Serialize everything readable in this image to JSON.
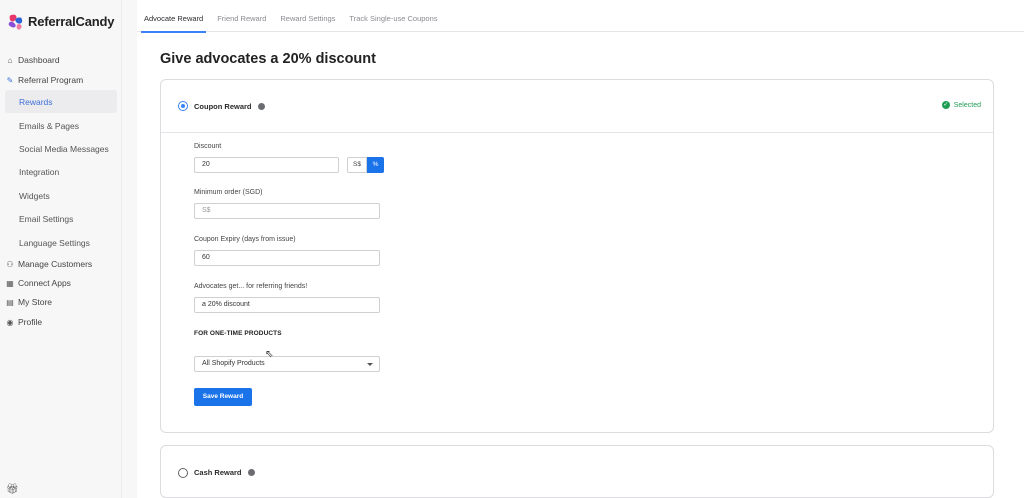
{
  "brand": {
    "name": "ReferralCandy"
  },
  "sidebar": {
    "items": [
      {
        "label": "Dashboard",
        "icon": "home-icon"
      },
      {
        "label": "Referral Program",
        "icon": "edit-icon"
      },
      {
        "label": "Manage Customers",
        "icon": "users-icon"
      },
      {
        "label": "Connect Apps",
        "icon": "grid-icon"
      },
      {
        "label": "My Store",
        "icon": "store-icon"
      },
      {
        "label": "Profile",
        "icon": "profile-icon"
      }
    ],
    "sub_items": [
      {
        "label": "Rewards",
        "active": true
      },
      {
        "label": "Emails & Pages"
      },
      {
        "label": "Social Media Messages"
      },
      {
        "label": "Integration"
      },
      {
        "label": "Widgets"
      },
      {
        "label": "Email Settings"
      },
      {
        "label": "Language Settings"
      }
    ]
  },
  "tabs": [
    {
      "label": "Advocate Reward",
      "active": true
    },
    {
      "label": "Friend Reward"
    },
    {
      "label": "Reward Settings"
    },
    {
      "label": "Track Single-use Coupons"
    }
  ],
  "page_title": "Give advocates a 20% discount",
  "coupon_card": {
    "title": "Coupon Reward",
    "selected_label": "Selected",
    "discount": {
      "label": "Discount",
      "value": "20",
      "unit_currency": "S$",
      "unit_percent": "%"
    },
    "min_order": {
      "label": "Minimum order (SGD)",
      "placeholder": "S$"
    },
    "expiry": {
      "label": "Coupon Expiry (days from issue)",
      "value": "60"
    },
    "advocates_get": {
      "label": "Advocates get... for referring friends!",
      "value": "a 20% discount"
    },
    "one_time_heading": "FOR ONE-TIME PRODUCTS",
    "products_select": "All Shopify Products",
    "save_label": "Save Reward"
  },
  "cash_card": {
    "title": "Cash Reward"
  },
  "colors": {
    "accent": "#1a73e8",
    "selected": "#1f9d55"
  }
}
